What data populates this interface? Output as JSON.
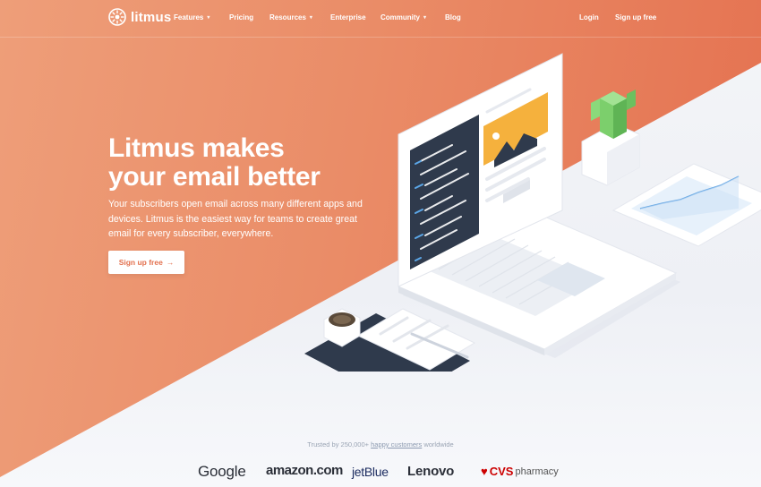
{
  "brand": {
    "name": "litmus",
    "logo_icon": "sun-gear-icon"
  },
  "nav": {
    "items": [
      {
        "label": "Features",
        "dropdown": true
      },
      {
        "label": "Pricing",
        "dropdown": false
      },
      {
        "label": "Resources",
        "dropdown": true
      },
      {
        "label": "Enterprise",
        "dropdown": false
      },
      {
        "label": "Community",
        "dropdown": true
      },
      {
        "label": "Blog",
        "dropdown": false
      }
    ],
    "login": "Login",
    "signup": "Sign up free"
  },
  "hero": {
    "headline_line1": "Litmus makes",
    "headline_line2": "your email better",
    "subtext": "Your subscribers open email across many different apps and devices. Litmus is the easiest way for teams to create great email for every subscriber, everywhere.",
    "cta_label": "Sign up free",
    "cta_icon": "→"
  },
  "trust": {
    "prefix": "Trusted by 250,000+",
    "link": "happy customers",
    "suffix": "worldwide",
    "logos": {
      "google": "Google",
      "amazon": "amazon.com",
      "jetblue": "jetBlue",
      "lenovo": "Lenovo",
      "cvs_main": "CVS",
      "cvs_sub": "pharmacy"
    }
  },
  "colors": {
    "hero_gradient_start": "#ee9e79",
    "hero_gradient_end": "#e4704f",
    "cta_text": "#e3714f",
    "code_panel": "#2f3a4c",
    "plant": "#7ccf6c",
    "image_tile": "#f5b13d"
  }
}
